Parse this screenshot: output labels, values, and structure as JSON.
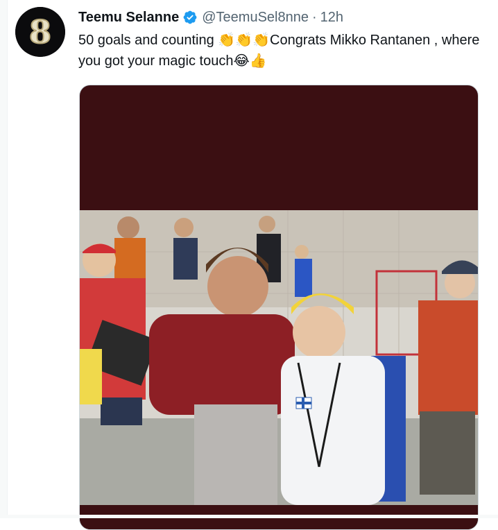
{
  "tweet": {
    "author_name": "Teemu Selanne",
    "handle": "@TeemuSel8nne",
    "separator": "·",
    "time": "12h",
    "text_part1": "50 goals and counting ",
    "emoji_clap": "👏👏👏",
    "text_part2": "Congrats Mikko Rantanen , where you got your magic touch",
    "emoji_end": "😂👍"
  },
  "avatar": {
    "glyph": "8",
    "icon": "number-8-logo"
  },
  "colors": {
    "verified": "#1d9bf0",
    "text": "#0f1419",
    "muted": "#536471",
    "media_bg": "#3b0f12"
  }
}
